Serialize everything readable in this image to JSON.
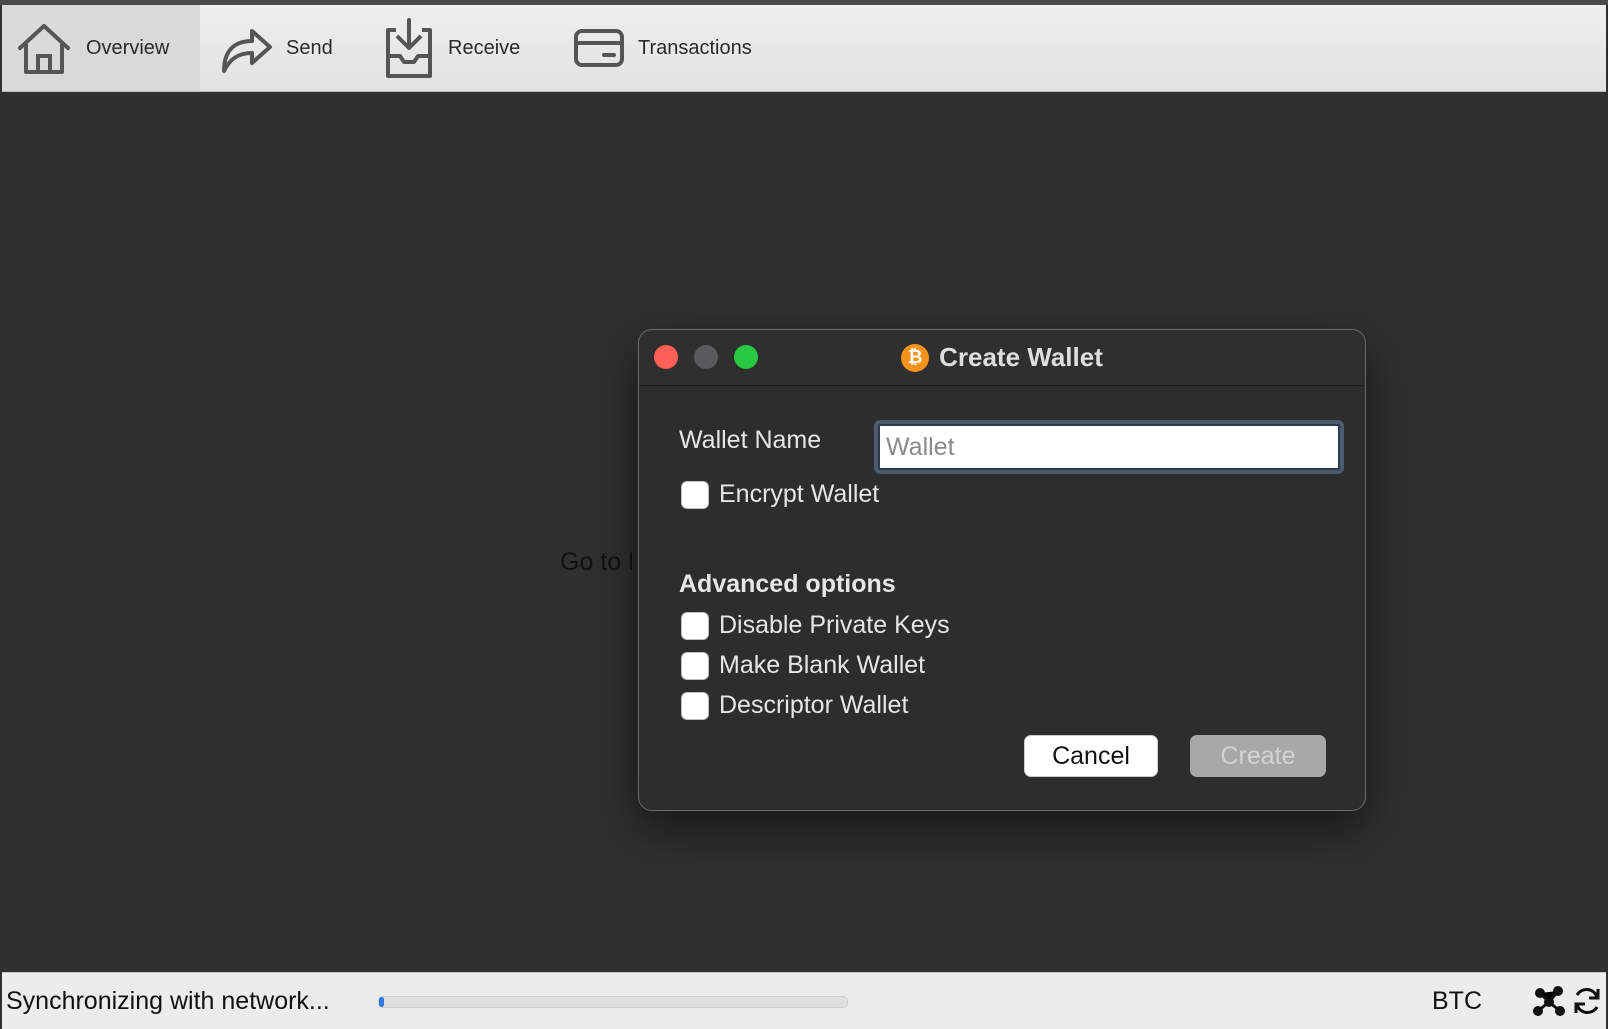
{
  "toolbar": {
    "items": [
      {
        "label": "Overview",
        "icon": "home-icon",
        "active": true
      },
      {
        "label": "Send",
        "icon": "send-arrow-icon"
      },
      {
        "label": "Receive",
        "icon": "receive-inbox-icon"
      },
      {
        "label": "Transactions",
        "icon": "card-icon"
      }
    ]
  },
  "background": {
    "partial_text": "Go to F"
  },
  "dialog": {
    "title": "Create Wallet",
    "title_icon": "bitcoin-icon",
    "wallet_name_label": "Wallet Name",
    "wallet_name_value": "",
    "wallet_name_placeholder": "Wallet",
    "encrypt_label": "Encrypt Wallet",
    "advanced_title": "Advanced options",
    "options": [
      {
        "label": "Disable Private Keys",
        "checked": false
      },
      {
        "label": "Make Blank Wallet",
        "checked": false
      },
      {
        "label": "Descriptor Wallet",
        "checked": false
      }
    ],
    "encrypt_checked": false,
    "cancel_label": "Cancel",
    "create_label": "Create",
    "create_enabled": false
  },
  "status": {
    "text": "Synchronizing with network...",
    "progress": 0.01,
    "unit": "BTC",
    "icons": [
      "network-icon",
      "sync-icon"
    ]
  },
  "colors": {
    "accent": "#2f7ae5",
    "bitcoin": "#f7931a",
    "close": "#fe5f57",
    "maximize": "#28c840"
  }
}
